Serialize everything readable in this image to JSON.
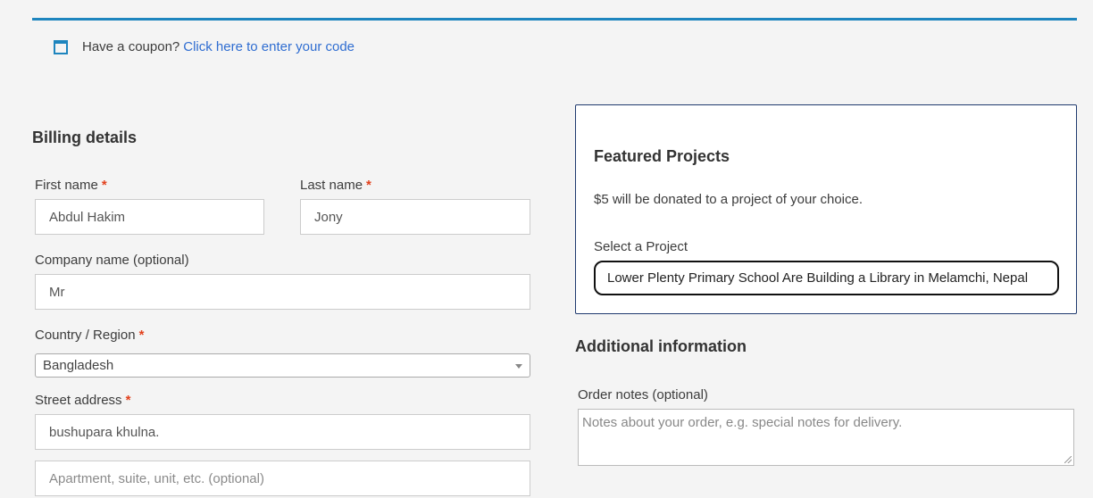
{
  "coupon": {
    "text": "Have a coupon?",
    "link": "Click here to enter your code"
  },
  "billing": {
    "heading": "Billing details",
    "first_name": {
      "label": "First name",
      "value": "Abdul Hakim"
    },
    "last_name": {
      "label": "Last name",
      "value": "Jony"
    },
    "company": {
      "label": "Company name (optional)",
      "value": "Mr"
    },
    "country": {
      "label": "Country / Region",
      "value": "Bangladesh"
    },
    "street": {
      "label": "Street address",
      "value": "bushupara khulna.",
      "placeholder2": "Apartment, suite, unit, etc. (optional)"
    },
    "required_mark": "*"
  },
  "featured": {
    "title": "Featured Projects",
    "description": "$5 will be donated to a project of your choice.",
    "select_label": "Select a Project",
    "selected": "Lower Plenty Primary School Are Building a Library in Melamchi, Nepal"
  },
  "additional": {
    "heading": "Additional information",
    "notes_label": "Order notes (optional)",
    "notes_placeholder": "Notes about your order, e.g. special notes for delivery."
  },
  "colors": {
    "accent": "#1e85be",
    "link": "#2f6dd1",
    "required": "#e2401c",
    "panel_border": "#1f3a6e"
  }
}
